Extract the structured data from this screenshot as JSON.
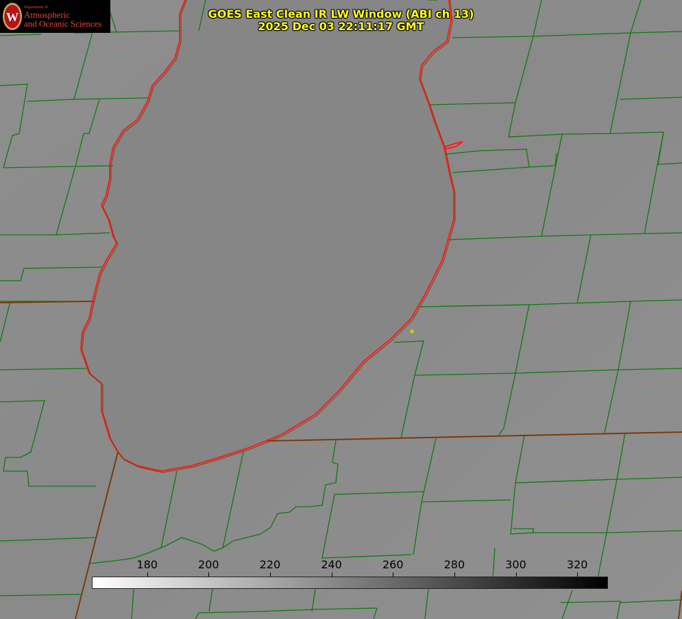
{
  "title": {
    "line1": "GOES East Clean IR LW Window (ABI ch 13)",
    "line2": "2025 Dec 03 22:11:17 GMT"
  },
  "logo": {
    "department": "Department of",
    "line1": "Atmospheric",
    "line2": "and Oceanic Sciences",
    "shield_letter": "W"
  },
  "colorbar": {
    "min_value": 162,
    "max_value": 330,
    "ticks": [
      "180",
      "200",
      "220",
      "240",
      "260",
      "280",
      "300",
      "320"
    ],
    "tick_values": [
      180,
      200,
      220,
      240,
      260,
      280,
      300,
      320
    ],
    "gradient_start_color": "#ffffff",
    "gradient_end_color": "#000000"
  },
  "colors": {
    "background_gray": "#8c8c8c",
    "lake_gray": "#858585",
    "county_lines": "#0e7a0e",
    "state_lines": "#7a3a0a",
    "coastline": "#ff1a1a",
    "title_text": "#ffff1a",
    "marker": "#d4c21a"
  }
}
